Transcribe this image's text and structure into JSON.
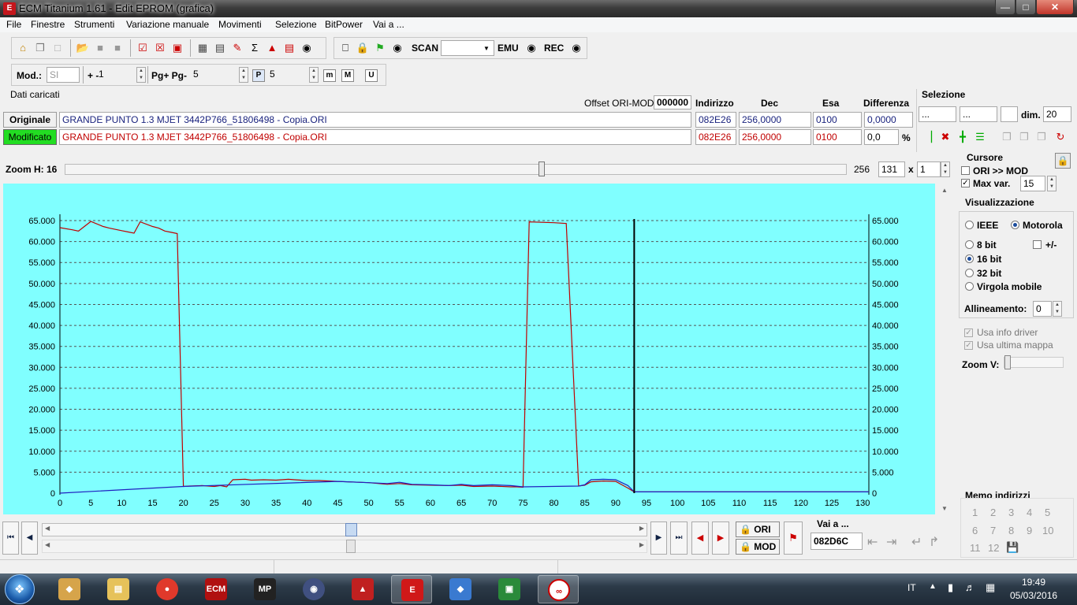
{
  "window": {
    "title": "ECM Titanium 1.61 - Edit EPROM (grafica)"
  },
  "menu": [
    "File",
    "Finestre",
    "Strumenti",
    "Variazione manuale",
    "Movimenti",
    "Selezione",
    "BitPower",
    "Vai a ..."
  ],
  "toolbar": {
    "scan_label": "SCAN",
    "emu_label": "EMU",
    "rec_label": "REC",
    "scan_value": ""
  },
  "toolbar2": {
    "mod_label": "Mod.:",
    "mod_value": "SI",
    "step_label": "+ -",
    "step_value": "1",
    "page_label": "Pg+ Pg-",
    "page_value": "5",
    "p_value": "5",
    "p_icon": "P",
    "m1_icon": "m",
    "m2_icon": "M",
    "u_icon": "U"
  },
  "loaded": {
    "title": "Dati caricati",
    "offset_label": "Offset ORI-MOD",
    "offset_value": "000000",
    "headers": {
      "address": "Indirizzo",
      "dec": "Dec",
      "hex": "Esa",
      "diff": "Differenza"
    },
    "original": {
      "label": "Originale",
      "file": "GRANDE PUNTO 1.3 MJET 3442P766_51806498 - Copia.ORI",
      "address": "082E26",
      "dec": "256,0000",
      "hex": "0100",
      "diff": "0,0000"
    },
    "modified": {
      "label": "Modificato",
      "file": "GRANDE PUNTO 1.3 MJET 3442P766_51806498 - Copia.ORI",
      "address": "082E26",
      "dec": "256,0000",
      "hex": "0100",
      "diff": "0,0",
      "pct": "%"
    }
  },
  "selection": {
    "title": "Selezione",
    "field1": "...",
    "field2": "...",
    "field3": "",
    "dim_label": "dim.",
    "dim_value": "20"
  },
  "zoom": {
    "label": "Zoom H: 16",
    "range_value": "256",
    "cols_value": "131",
    "times_label": "x",
    "rows_value": "1",
    "level": 0.61
  },
  "cursor_panel": {
    "title": "Cursore",
    "ori_mod_label": "ORI >> MOD",
    "ori_mod_checked": false,
    "maxvar_label": "Max var.",
    "maxvar_checked": true,
    "maxvar_value": "15"
  },
  "view_panel": {
    "title": "Visualizzazione",
    "ieee": "IEEE",
    "motorola": "Motorola",
    "bit8": "8 bit",
    "plusminus": "+/-",
    "bit16": "16 bit",
    "bit32": "32 bit",
    "float": "Virgola mobile",
    "align_label": "Allineamento:",
    "align_value": "0",
    "driver_info": "Usa info driver",
    "last_map": "Usa ultima mappa",
    "zoomv_label": "Zoom V:"
  },
  "memo": {
    "title": "Memo indirizzi",
    "slots": [
      "1",
      "2",
      "3",
      "4",
      "5",
      "6",
      "7",
      "8",
      "9",
      "10",
      "11",
      "12"
    ]
  },
  "bottom": {
    "ori_label": "ORI",
    "mod_label": "MOD",
    "goto_label": "Vai a ...",
    "goto_value": "082D6C",
    "slider_pos": 0.51
  },
  "chart_data": {
    "type": "line",
    "xlim": [
      0,
      131
    ],
    "ylim": [
      0,
      65000
    ],
    "xticks": [
      0,
      5,
      10,
      15,
      20,
      25,
      30,
      35,
      40,
      45,
      50,
      55,
      60,
      65,
      70,
      75,
      80,
      85,
      90,
      95,
      100,
      105,
      110,
      115,
      120,
      125,
      130
    ],
    "yticks": [
      0,
      5000,
      10000,
      15000,
      20000,
      25000,
      30000,
      35000,
      40000,
      45000,
      50000,
      55000,
      60000,
      65000
    ],
    "ytick_labels": [
      "0",
      "5.000",
      "10.000",
      "15.000",
      "20.000",
      "25.000",
      "30.000",
      "35.000",
      "40.000",
      "45.000",
      "50.000",
      "55.000",
      "60.000",
      "65.000"
    ],
    "grid": true,
    "cursor_x": 93,
    "series": [
      {
        "color": "#c00000",
        "x": [
          0,
          2,
          3,
          5,
          7,
          8,
          10,
          11,
          12,
          13,
          15,
          16,
          17,
          18,
          19,
          20,
          21,
          23,
          25,
          26,
          27,
          28,
          30,
          31,
          33,
          35,
          37,
          38,
          40,
          42,
          45,
          50,
          53,
          55,
          57,
          60,
          63,
          65,
          67,
          70,
          73,
          74,
          75,
          76,
          80,
          82,
          84,
          85,
          86,
          88,
          90,
          92,
          93,
          95,
          100,
          131
        ],
        "y": [
          63300,
          62800,
          62500,
          64800,
          63600,
          63200,
          62600,
          62300,
          62000,
          64700,
          63600,
          63200,
          62500,
          62200,
          61900,
          1600,
          1700,
          1800,
          1600,
          1800,
          1500,
          3200,
          3300,
          3100,
          3200,
          3100,
          3300,
          3200,
          3000,
          3000,
          2800,
          2500,
          2100,
          2300,
          2000,
          1900,
          1800,
          1900,
          1600,
          1700,
          1500,
          1500,
          1400,
          64700,
          64500,
          64300,
          1700,
          1900,
          2700,
          2900,
          2800,
          1200,
          300,
          300,
          300,
          300
        ]
      },
      {
        "color": "#2020c0",
        "x": [
          0,
          20,
          45,
          50,
          53,
          55,
          57,
          60,
          63,
          65,
          67,
          70,
          73,
          75,
          84,
          85,
          86,
          88,
          90,
          92,
          93,
          131
        ],
        "y": [
          0,
          1600,
          2800,
          2500,
          2300,
          2600,
          2100,
          2000,
          1800,
          2100,
          1800,
          2000,
          1800,
          1500,
          1700,
          2000,
          3200,
          3300,
          3200,
          1800,
          300,
          300
        ]
      }
    ]
  }
}
